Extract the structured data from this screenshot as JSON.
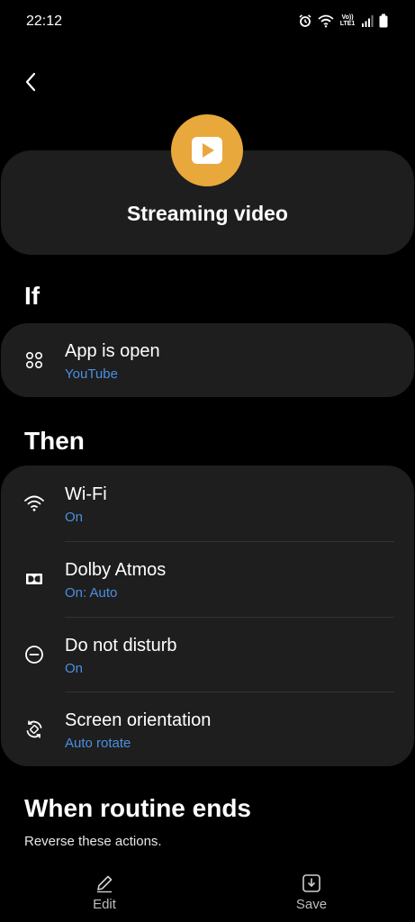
{
  "status_bar": {
    "time": "22:12",
    "network_label_top": "Vo))",
    "network_label_bottom": "LTE1",
    "icons": [
      "alarm-icon",
      "wifi-icon",
      "signal-icon",
      "battery-icon"
    ]
  },
  "header": {
    "back_icon": "chevron-left-icon",
    "routine_icon": "play-icon",
    "routine_icon_color": "#e9a83b",
    "title": "Streaming video"
  },
  "if_section": {
    "heading": "If",
    "items": [
      {
        "icon": "apps-grid-icon",
        "title": "App is open",
        "subtitle": "YouTube"
      }
    ]
  },
  "then_section": {
    "heading": "Then",
    "items": [
      {
        "icon": "wifi-icon",
        "title": "Wi-Fi",
        "subtitle": "On"
      },
      {
        "icon": "dolby-icon",
        "title": "Dolby Atmos",
        "subtitle": "On: Auto"
      },
      {
        "icon": "do-not-disturb-icon",
        "title": "Do not disturb",
        "subtitle": "On"
      },
      {
        "icon": "rotate-icon",
        "title": "Screen orientation",
        "subtitle": "Auto rotate"
      }
    ]
  },
  "ends_section": {
    "heading": "When routine ends",
    "subtitle": "Reverse these actions."
  },
  "bottom_bar": {
    "edit_label": "Edit",
    "save_label": "Save"
  },
  "colors": {
    "background": "#000000",
    "card": "#1e1e1e",
    "accent_blue": "#4a90e2",
    "routine_yellow": "#e9a83b"
  }
}
